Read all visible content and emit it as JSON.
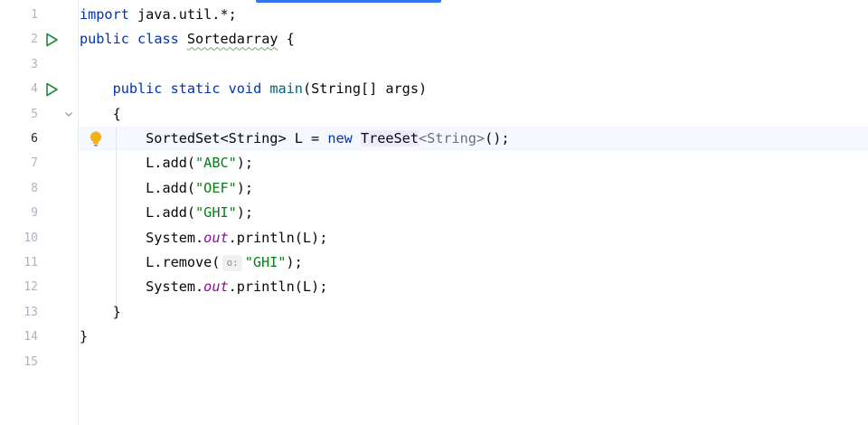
{
  "editor": {
    "line_numbers": [
      "1",
      "2",
      "3",
      "4",
      "5",
      "6",
      "7",
      "8",
      "9",
      "10",
      "11",
      "12",
      "13",
      "14",
      "15"
    ],
    "current_line": 6,
    "gutter_icons": {
      "run_class": "run-icon",
      "run_main": "run-icon",
      "fold": "chevron-down-icon",
      "bulb": "lightbulb-icon"
    },
    "lines": {
      "l1": {
        "kw_import": "import",
        "rest": " java.util.*;"
      },
      "l2": {
        "kw_public": "public",
        "kw_class": "class",
        "class_name": "Sortedarray",
        "brace": "{"
      },
      "l4": {
        "kw_public": "public",
        "kw_static": "static",
        "kw_void": "void",
        "method": "main",
        "params": "(String[] args)"
      },
      "l5": {
        "brace": "{"
      },
      "l6": {
        "t1": "SortedSet<String> L = ",
        "kw_new": "new",
        "cls": "TreeSet",
        "gen": "<String>",
        "end": "();"
      },
      "l7": {
        "pre": "L.add(",
        "str": "\"ABC\"",
        "post": ");"
      },
      "l8": {
        "pre": "L.add(",
        "str": "\"OEF\"",
        "post": ");"
      },
      "l9": {
        "pre": "L.add(",
        "str": "\"GHI\"",
        "post": ");"
      },
      "l10": {
        "pre": "System.",
        "field": "out",
        "post": ".println(L);"
      },
      "l11": {
        "pre": "L.remove(",
        "hint": "o:",
        "str": "\"GHI\"",
        "post": ");"
      },
      "l12": {
        "pre": "System.",
        "field": "out",
        "post": ".println(L);"
      },
      "l13": {
        "brace": "}"
      },
      "l14": {
        "brace": "}"
      }
    }
  }
}
